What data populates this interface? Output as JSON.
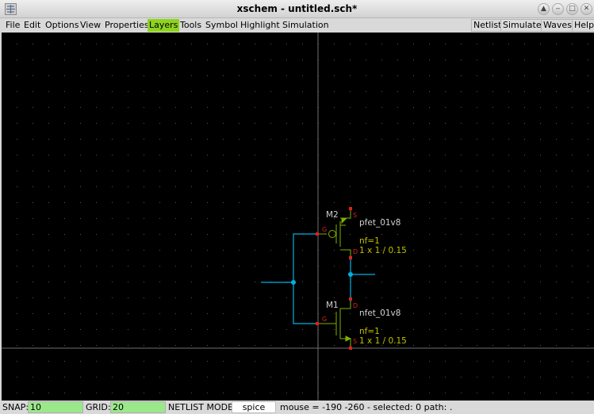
{
  "window": {
    "title": "xschem - untitled.sch*",
    "icon": "xschem-app-icon",
    "controls": [
      "up-icon",
      "minimize-icon",
      "maximize-icon",
      "close-icon"
    ]
  },
  "menubar": {
    "left": [
      {
        "id": "file",
        "label": "File"
      },
      {
        "id": "edit",
        "label": "Edit"
      },
      {
        "id": "options",
        "label": "Options"
      },
      {
        "id": "view",
        "label": "View"
      },
      {
        "id": "properties",
        "label": "Properties"
      },
      {
        "id": "layers",
        "label": "Layers",
        "active": true
      },
      {
        "id": "tools",
        "label": "Tools"
      },
      {
        "id": "symbol",
        "label": "Symbol"
      },
      {
        "id": "highlight",
        "label": "Highlight"
      },
      {
        "id": "simulation",
        "label": "Simulation"
      }
    ],
    "right": [
      {
        "id": "netlist",
        "label": "Netlist"
      },
      {
        "id": "simulate",
        "label": "Simulate"
      },
      {
        "id": "waves",
        "label": "Waves"
      },
      {
        "id": "help",
        "label": "Help"
      }
    ]
  },
  "schematic": {
    "background": "#000000",
    "colors": {
      "wire": "#00b0e0",
      "symbol": "#80b000",
      "pin": "#e02020",
      "text": "#d0d0d0",
      "attr": "#c0c000",
      "grid": "#555555",
      "crosshair": "#707070",
      "active_menu": "#8ed41e"
    },
    "components": [
      {
        "ref": "M2",
        "model": "pfet_01v8",
        "nf": "nf=1",
        "size": "1 x 1 / 0.15",
        "pins": {
          "gate": "G",
          "source": "S",
          "drain": "D"
        }
      },
      {
        "ref": "M1",
        "model": "nfet_01v8",
        "nf": "nf=1",
        "size": "1 x 1 / 0.15",
        "pins": {
          "gate": "G",
          "drain": "D",
          "source": "S"
        }
      }
    ]
  },
  "statusbar": {
    "snap_label": "SNAP:",
    "snap_value": "10",
    "grid_label": "GRID:",
    "grid_value": "20",
    "netlist_mode_label": "NETLIST MODE:",
    "netlist_mode_value": "spice",
    "info": "mouse = -190 -260 - selected: 0 path: ."
  }
}
